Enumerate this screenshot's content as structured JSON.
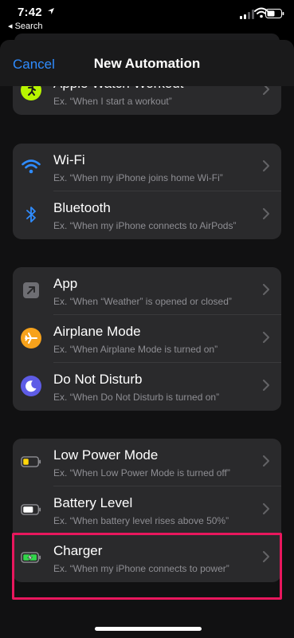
{
  "status_bar": {
    "time": "7:42",
    "back_label": "◂ Search"
  },
  "nav": {
    "cancel": "Cancel",
    "title": "New Automation"
  },
  "groups": [
    {
      "rows": [
        {
          "title": "Apple Watch Workout",
          "subtitle": "Ex. “When I start a workout”",
          "icon": "workout-icon"
        }
      ]
    },
    {
      "rows": [
        {
          "title": "Wi-Fi",
          "subtitle": "Ex. “When my iPhone joins home Wi-Fi”",
          "icon": "wifi-icon"
        },
        {
          "title": "Bluetooth",
          "subtitle": "Ex. “When my iPhone connects to AirPods”",
          "icon": "bluetooth-icon"
        }
      ]
    },
    {
      "rows": [
        {
          "title": "App",
          "subtitle": "Ex. “When “Weather” is opened or closed”",
          "icon": "app-icon"
        },
        {
          "title": "Airplane Mode",
          "subtitle": "Ex. “When Airplane Mode is turned on”",
          "icon": "airplane-icon"
        },
        {
          "title": "Do Not Disturb",
          "subtitle": "Ex. “When Do Not Disturb is turned on”",
          "icon": "moon-icon"
        }
      ]
    },
    {
      "rows": [
        {
          "title": "Low Power Mode",
          "subtitle": "Ex. “When Low Power Mode is turned off”",
          "icon": "low-power-icon"
        },
        {
          "title": "Battery Level",
          "subtitle": "Ex. “When battery level rises above 50%”",
          "icon": "battery-level-icon"
        },
        {
          "title": "Charger",
          "subtitle": "Ex. “When my iPhone connects to power”",
          "icon": "charger-icon"
        }
      ]
    }
  ],
  "colors": {
    "accent": "#2f8cff",
    "highlight": "#e8175d",
    "workout": "#b8f500",
    "wifi": "#2f8cff",
    "airplane": "#f7a21b",
    "moon": "#5e5ce6",
    "low_power": "#ffd60a",
    "charger": "#32d74b"
  }
}
